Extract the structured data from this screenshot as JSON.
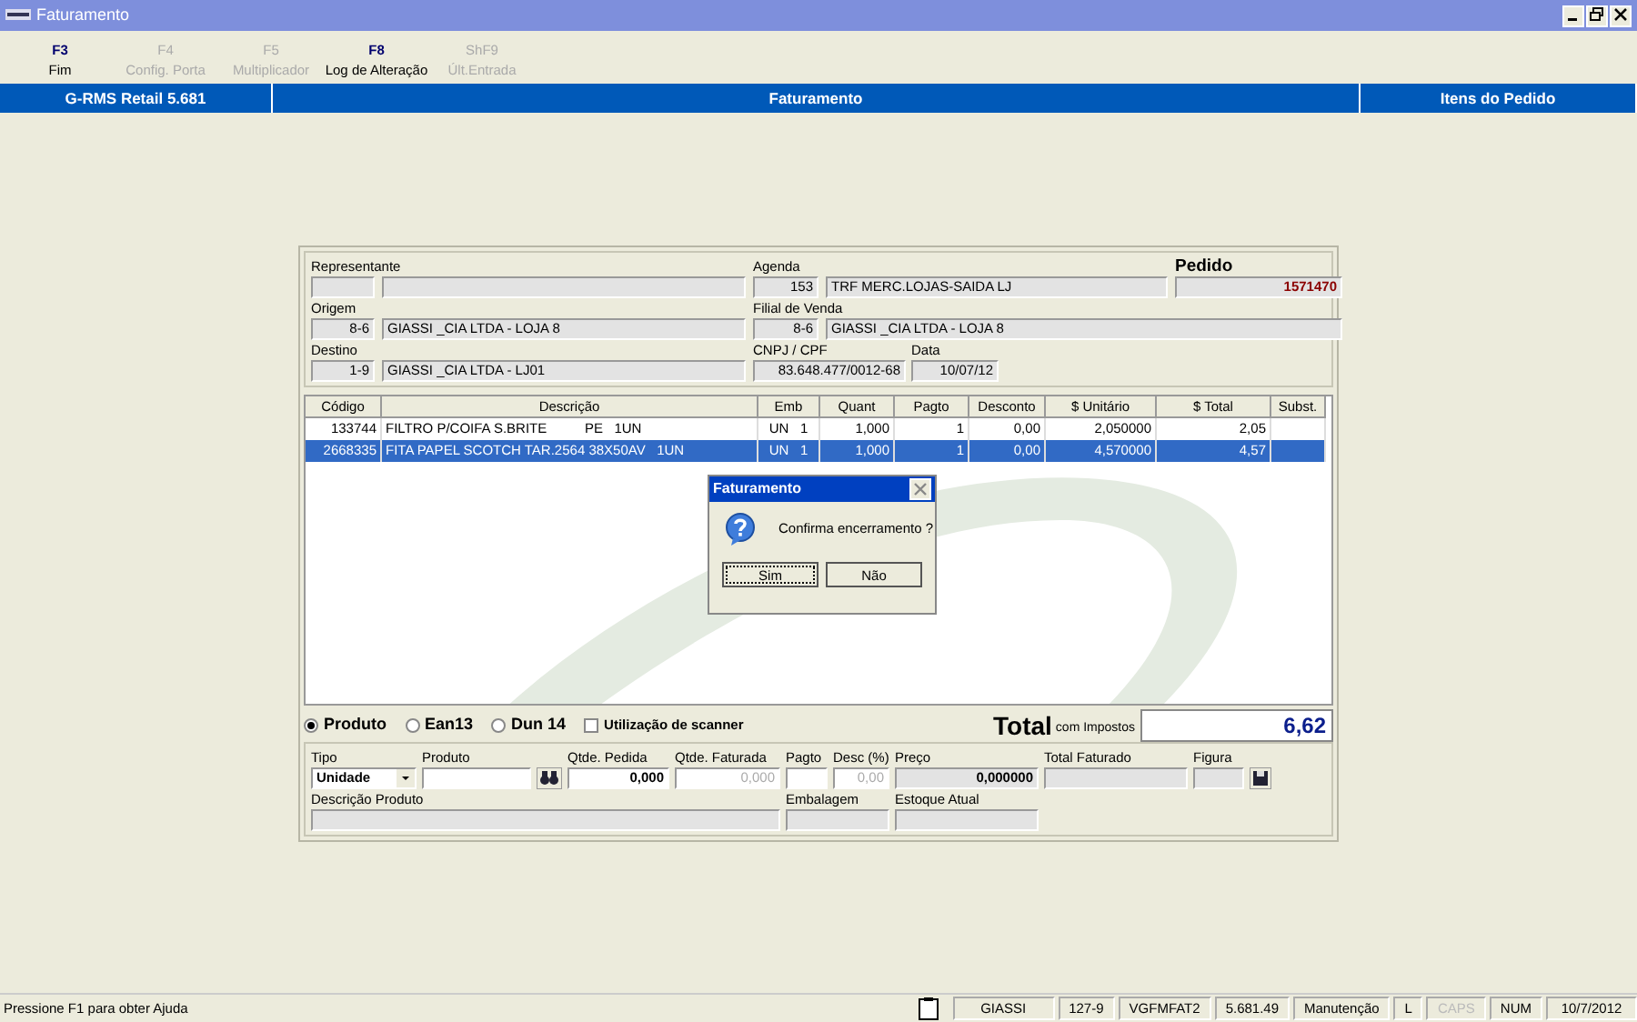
{
  "window": {
    "title": "Faturamento"
  },
  "toolbar": [
    {
      "key": "F3",
      "label": "Fim",
      "disabled": false
    },
    {
      "key": "F4",
      "label": "Config. Porta",
      "disabled": true
    },
    {
      "key": "F5",
      "label": "Multiplicador",
      "disabled": true
    },
    {
      "key": "F8",
      "label": "Log de Alteração",
      "disabled": false
    },
    {
      "key": "ShF9",
      "label": "Últ.Entrada",
      "disabled": true
    }
  ],
  "header_bar": [
    "G-RMS Retail 5.681",
    "Faturamento",
    "Itens do Pedido"
  ],
  "order": {
    "representante_label": "Representante",
    "agenda_label": "Agenda",
    "agenda_code": "153",
    "agenda_name": "TRF MERC.LOJAS-SAIDA LJ",
    "pedido_label": "Pedido",
    "pedido": "1571470",
    "origem_label": "Origem",
    "origem_code": "8-6",
    "origem_name": "GIASSI _CIA LTDA - LOJA 8",
    "filial_label": "Filial de Venda",
    "filial_code": "8-6",
    "filial_name": "GIASSI _CIA LTDA - LOJA 8",
    "destino_label": "Destino",
    "destino_code": "1-9",
    "destino_name": "GIASSI _CIA LTDA - LJ01",
    "cnpj_label": "CNPJ / CPF",
    "cnpj": "83.648.477/0012-68",
    "data_label": "Data",
    "data": "10/07/12"
  },
  "table": {
    "columns": [
      "Código",
      "Descrição",
      "Emb",
      "Quant",
      "Pagto",
      "Desconto",
      "$ Unitário",
      "$ Total",
      "Subst."
    ],
    "rows": [
      {
        "selected": false,
        "cells": [
          "133744",
          "FILTRO P/COIFA S.BRITE          PE   1UN",
          "UN   1",
          "1,000",
          "1",
          "0,00",
          "2,050000",
          "2,05",
          ""
        ]
      },
      {
        "selected": true,
        "cells": [
          "2668335",
          "FITA PAPEL SCOTCH TAR.2564 38X50AV   1UN",
          "UN   1",
          "1,000",
          "1",
          "0,00",
          "4,570000",
          "4,57",
          ""
        ]
      }
    ]
  },
  "search_mode": [
    {
      "label": "Produto",
      "selected": true
    },
    {
      "label": "Ean13",
      "selected": false
    },
    {
      "label": "Dun 14",
      "selected": false
    }
  ],
  "scanner": {
    "label": "Utilização de scanner",
    "checked": false
  },
  "total": {
    "label": "Total",
    "sublabel": "com Impostos",
    "value": "6,62"
  },
  "entry": {
    "tipo_label": "Tipo",
    "tipo": "Unidade",
    "produto_label": "Produto",
    "qtde_pedida_label": "Qtde. Pedida",
    "qtde_pedida": "0,000",
    "qtde_faturada_label": "Qtde. Faturada",
    "qtde_faturada": "0,000",
    "pagto_label": "Pagto",
    "desc_label": "Desc (%)",
    "desc": "0,00",
    "preco_label": "Preço",
    "preco": "0,000000",
    "total_faturado_label": "Total Faturado",
    "figura_label": "Figura",
    "descricao_label": "Descrição Produto",
    "embalagem_label": "Embalagem",
    "estoque_label": "Estoque Atual"
  },
  "dialog": {
    "title": "Faturamento",
    "message": "Confirma encerramento ?",
    "buttons": [
      {
        "label": "Sim",
        "default": true
      },
      {
        "label": "Não",
        "default": false
      }
    ]
  },
  "status_bar": {
    "hint": "Pressione F1 para obter Ajuda",
    "cells": [
      {
        "text": "GIASSI",
        "disabled": false
      },
      {
        "text": "127-9",
        "disabled": false
      },
      {
        "text": "VGFMFAT2",
        "disabled": false
      },
      {
        "text": "5.681.49",
        "disabled": false
      },
      {
        "text": "Manutenção",
        "disabled": false
      },
      {
        "text": "L",
        "disabled": false
      },
      {
        "text": "CAPS",
        "disabled": true
      },
      {
        "text": "NUM",
        "disabled": false
      },
      {
        "text": "10/7/2012",
        "disabled": false
      }
    ]
  }
}
